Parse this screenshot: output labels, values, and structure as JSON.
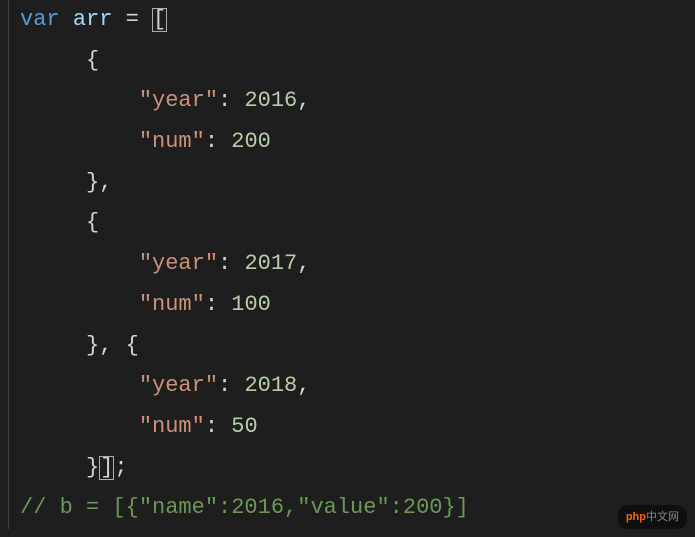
{
  "code": {
    "keyword_var": "var",
    "var_name": "arr",
    "equals": "=",
    "open_bracket": "[",
    "close_bracket": "]",
    "open_brace": "{",
    "close_brace": "}",
    "comma": ",",
    "colon": ":",
    "semicolon": ";",
    "entries": [
      {
        "key1": "\"year\"",
        "val1": "2016",
        "key2": "\"num\"",
        "val2": "200"
      },
      {
        "key1": "\"year\"",
        "val1": "2017",
        "key2": "\"num\"",
        "val2": "100"
      },
      {
        "key1": "\"year\"",
        "val1": "2018",
        "key2": "\"num\"",
        "val2": "50"
      }
    ],
    "comment": "// b = [{\"name\":2016,\"value\":200}]"
  },
  "watermark": {
    "brand_prefix": "php",
    "brand_cn": "中文网"
  }
}
